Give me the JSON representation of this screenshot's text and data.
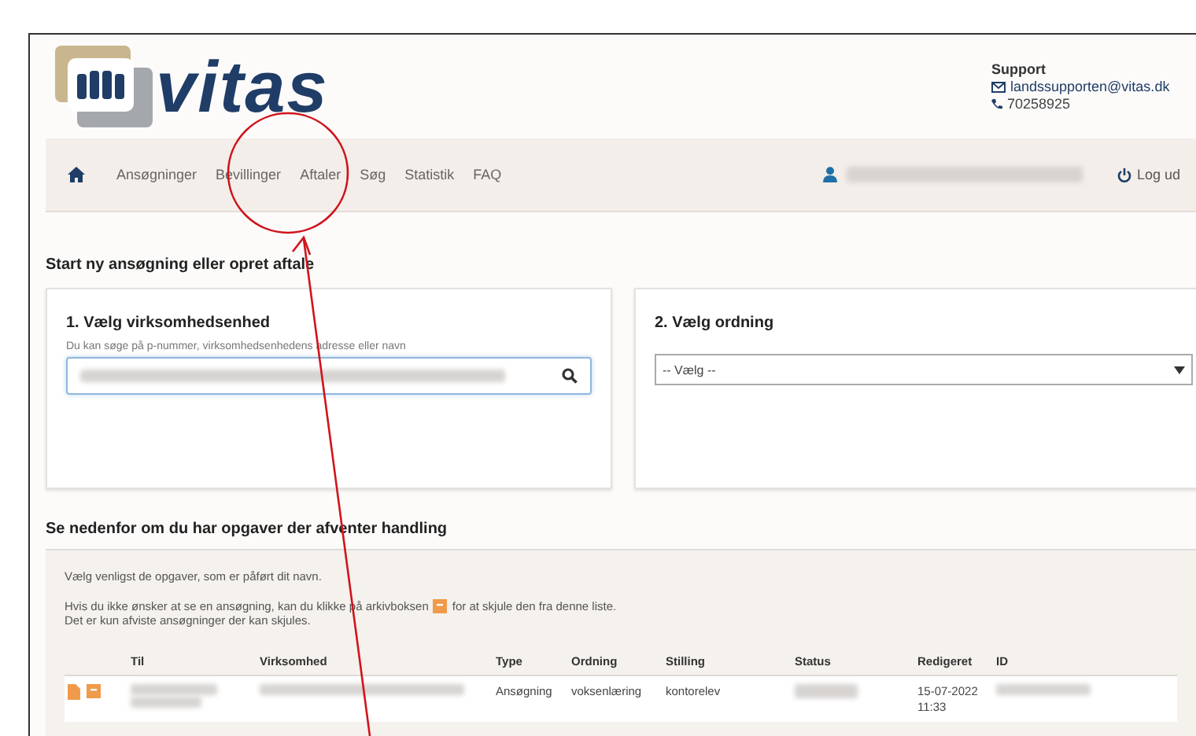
{
  "logo": {
    "text": "vitas"
  },
  "support": {
    "title": "Support",
    "email": "landssupporten@vitas.dk",
    "phone": "70258925"
  },
  "nav": {
    "items": [
      {
        "label": "Ansøgninger",
        "selected": false
      },
      {
        "label": "Bevillinger",
        "selected": false
      },
      {
        "label": "Aftaler",
        "selected": false
      },
      {
        "label": "Søg",
        "selected": false
      },
      {
        "label": "Statistik",
        "selected": false
      },
      {
        "label": "FAQ",
        "selected": false
      }
    ],
    "logout": "Log ud"
  },
  "start": {
    "title": "Start ny ansøgning eller opret aftale",
    "unit": {
      "heading": "1. Vælg virksomhedsenhed",
      "hint": "Du kan søge på p-nummer, virksomhedsenhedens adresse eller navn"
    },
    "scheme": {
      "heading": "2. Vælg ordning",
      "value": "-- Vælg --"
    }
  },
  "tasks": {
    "title": "Se nedenfor om du har opgaver der afventer handling",
    "intro": "Vælg venligst de opgaver, som er påført dit navn.",
    "archive_before": "Hvis du ikke ønsker at se en ansøgning, kan du klikke på arkivboksen",
    "archive_after": "for at skjule den fra denne liste.",
    "archive_note": "Det er kun afviste ansøgninger der kan skjules.",
    "columns": [
      "Til",
      "Virksomhed",
      "Type",
      "Ordning",
      "Stilling",
      "Status",
      "Redigeret",
      "ID"
    ],
    "rows": [
      {
        "type": "Ansøgning",
        "ordning": "voksenlæring",
        "stilling": "kontorelev",
        "date": "15-07-2022",
        "time": "11:33"
      }
    ]
  }
}
